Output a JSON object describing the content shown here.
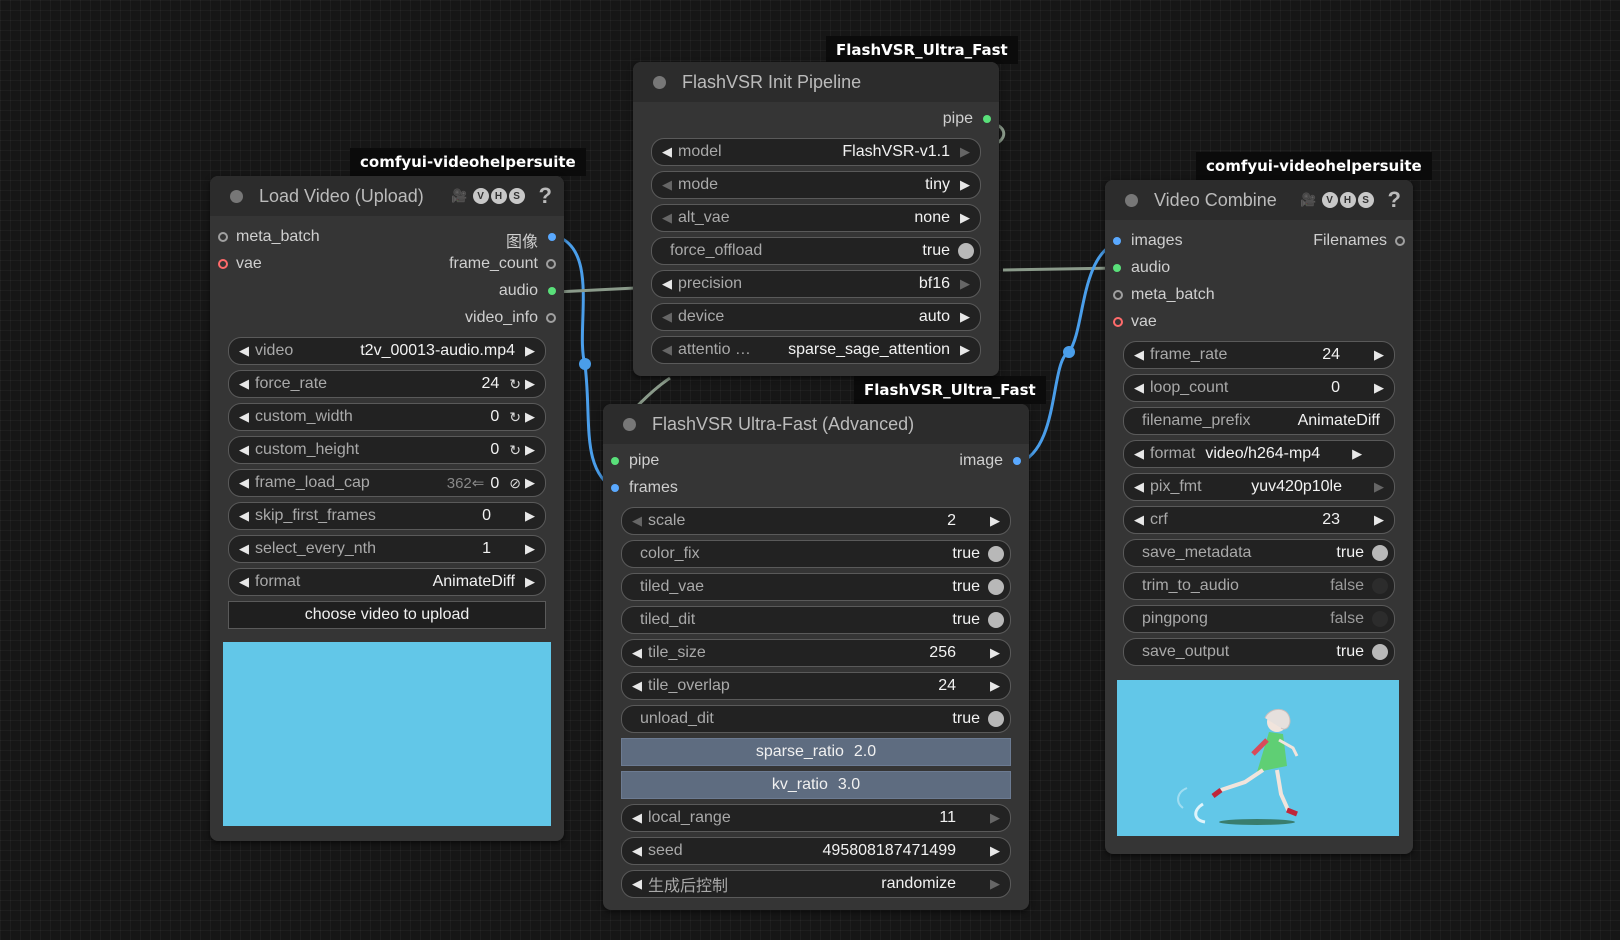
{
  "badges": {
    "load": "comfyui-videohelpersuite",
    "init": "FlashVSR_Ultra_Fast",
    "adv": "FlashVSR_Ultra_Fast",
    "combine": "comfyui-videohelpersuite"
  },
  "load_node": {
    "title": "Load Video (Upload)",
    "inputs": [
      "meta_batch",
      "vae"
    ],
    "outputs": [
      "图像",
      "frame_count",
      "audio",
      "video_info"
    ],
    "widgets": [
      {
        "name": "video",
        "value": "t2v_00013-audio.mp4"
      },
      {
        "name": "force_rate",
        "value": "24"
      },
      {
        "name": "custom_width",
        "value": "0"
      },
      {
        "name": "custom_height",
        "value": "0"
      },
      {
        "name": "frame_load_cap",
        "value": "0",
        "extra": "362⇐"
      },
      {
        "name": "skip_first_frames",
        "value": "0"
      },
      {
        "name": "select_every_nth",
        "value": "1"
      },
      {
        "name": "format",
        "value": "AnimateDiff"
      }
    ],
    "upload_button": "choose video to upload"
  },
  "init_node": {
    "title": "FlashVSR Init Pipeline",
    "output": "pipe",
    "widgets": [
      {
        "name": "model",
        "value": "FlashVSR-v1.1"
      },
      {
        "name": "mode",
        "value": "tiny"
      },
      {
        "name": "alt_vae",
        "value": "none"
      },
      {
        "name": "force_offload",
        "value": "true"
      },
      {
        "name": "precision",
        "value": "bf16"
      },
      {
        "name": "device",
        "value": "auto"
      },
      {
        "name": "attentio …",
        "value": "sparse_sage_attention"
      }
    ]
  },
  "adv_node": {
    "title": "FlashVSR Ultra-Fast (Advanced)",
    "inputs": [
      "pipe",
      "frames"
    ],
    "output": "image",
    "widgets": [
      {
        "name": "scale",
        "value": "2"
      },
      {
        "name": "color_fix",
        "value": "true"
      },
      {
        "name": "tiled_vae",
        "value": "true"
      },
      {
        "name": "tiled_dit",
        "value": "true"
      },
      {
        "name": "tile_size",
        "value": "256"
      },
      {
        "name": "tile_overlap",
        "value": "24"
      },
      {
        "name": "unload_dit",
        "value": "true"
      },
      {
        "name": "sparse_ratio",
        "value": "2.0"
      },
      {
        "name": "kv_ratio",
        "value": "3.0"
      },
      {
        "name": "local_range",
        "value": "11"
      },
      {
        "name": "seed",
        "value": "495808187471499"
      },
      {
        "name": "生成后控制",
        "value": "randomize"
      }
    ]
  },
  "combine_node": {
    "title": "Video Combine",
    "inputs": [
      "images",
      "audio",
      "meta_batch",
      "vae"
    ],
    "output": "Filenames",
    "widgets": [
      {
        "name": "frame_rate",
        "value": "24"
      },
      {
        "name": "loop_count",
        "value": "0"
      },
      {
        "name": "filename_prefix",
        "value": "AnimateDiff"
      },
      {
        "name": "format",
        "value": "video/h264-mp4"
      },
      {
        "name": "pix_fmt",
        "value": "yuv420p10le"
      },
      {
        "name": "crf",
        "value": "23"
      },
      {
        "name": "save_metadata",
        "value": "true"
      },
      {
        "name": "trim_to_audio",
        "value": "false"
      },
      {
        "name": "pingpong",
        "value": "false"
      },
      {
        "name": "save_output",
        "value": "true"
      }
    ]
  },
  "icons": {
    "vhs": [
      "V",
      "H",
      "S"
    ],
    "help": "?"
  },
  "colors": {
    "image_pin": "#5aa9ff",
    "audio_pin": "#59e07a",
    "vae_pin": "#ff6b6b",
    "generic_pin": "#a0a0a0",
    "image_wire": "#4a9eea",
    "audio_wire": "#8a9a8a",
    "preview_bg": "#62c7e8"
  }
}
